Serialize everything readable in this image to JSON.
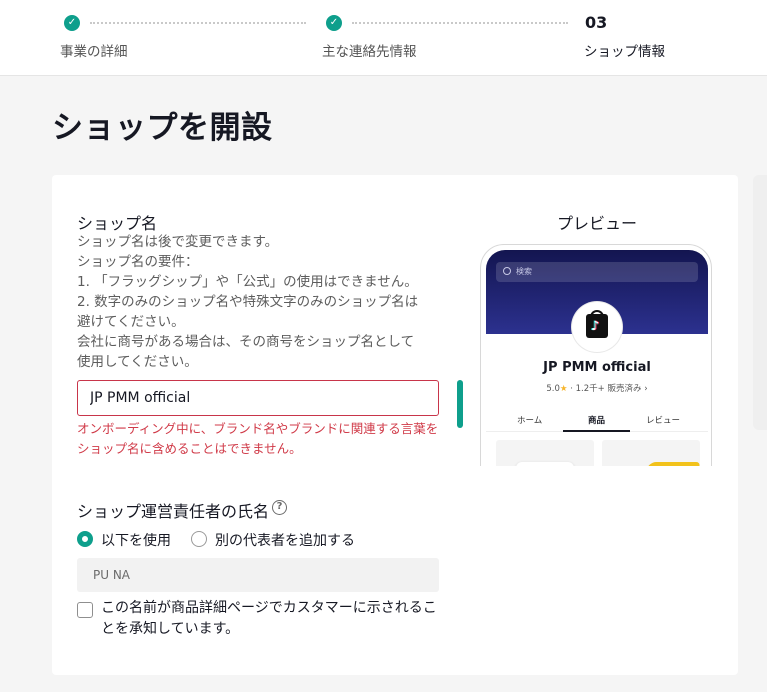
{
  "stepper": {
    "steps": [
      {
        "label": "事業の詳細",
        "status": "done"
      },
      {
        "label": "主な連絡先情報",
        "status": "done"
      },
      {
        "label": "ショップ情報",
        "number": "03",
        "status": "current"
      }
    ],
    "check_glyph": "✓",
    "accent": "#0e9f8c"
  },
  "page_title": "ショップを開設",
  "shop_name": {
    "title": "ショップ名",
    "desc_lines": [
      "ショップ名は後で変更できます。",
      "ショップ名の要件：",
      "1. 「フラッグシップ」や「公式」の使用はできません。",
      "2. 数字のみのショップ名や特殊文字のみのショップ名は",
      "避けてください。",
      "会社に商号がある場合は、その商号をショップ名として",
      "使用してください。"
    ],
    "value": "JP PMM official",
    "error": "オンボーディング中に、ブランド名やブランドに関連する言葉をショップ名に含めることはできません。",
    "error_color": "#d03a48"
  },
  "manager": {
    "title": "ショップ運営責任者の氏名",
    "help_glyph": "?",
    "options": [
      {
        "label": "以下を使用",
        "selected": true
      },
      {
        "label": "別の代表者を追加する",
        "selected": false
      }
    ],
    "value": "PU NA",
    "consent": "この名前が商品詳細ページでカスタマーに示されることを承知しています。",
    "consent_checked": false
  },
  "preview": {
    "title": "プレビュー",
    "search_placeholder": "検索",
    "shop_name": "JP PMM official",
    "rating": "5.0",
    "star_glyph": "★",
    "sold": "· 1.2千+ 販売済み ›",
    "tabs": [
      "ホーム",
      "商品",
      "レビュー"
    ],
    "active_tab": "商品",
    "avatar_glyph": "♪"
  }
}
